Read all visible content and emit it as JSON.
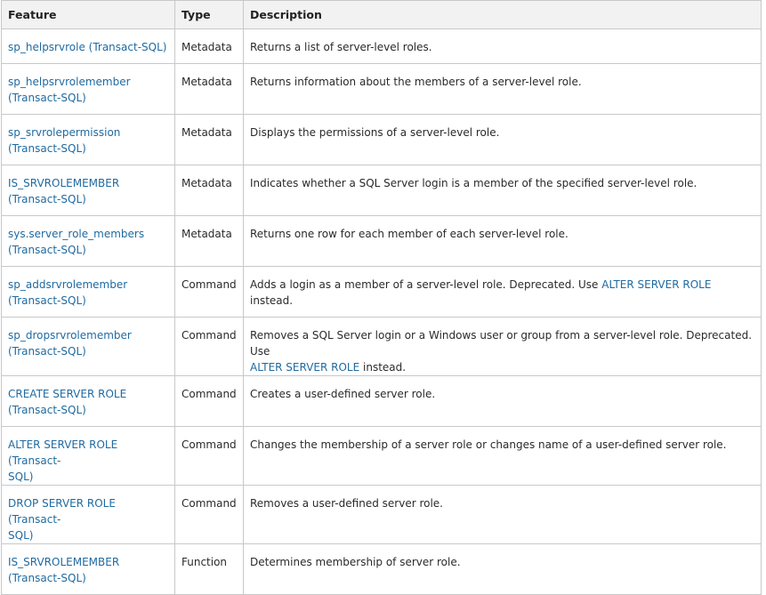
{
  "header": {
    "feature": "Feature",
    "type": "Type",
    "description": "Description"
  },
  "rows": [
    {
      "feature": [
        "sp_helpsrvrole (Transact-SQL)"
      ],
      "type": "Metadata",
      "desc": [
        "Returns a list of server-level roles."
      ]
    },
    {
      "feature": [
        "sp_helpsrvrolemember",
        "(Transact-SQL)"
      ],
      "type": "Metadata",
      "desc": [
        "Returns information about the members of a server-level role."
      ]
    },
    {
      "feature": [
        "sp_srvrolepermission",
        "(Transact-SQL)"
      ],
      "type": "Metadata",
      "desc": [
        "Displays the permissions of a server-level role."
      ]
    },
    {
      "feature": [
        "IS_SRVROLEMEMBER",
        "(Transact-SQL)"
      ],
      "type": "Metadata",
      "desc": [
        "Indicates whether a SQL Server login is a member of the specified server-level role."
      ]
    },
    {
      "feature": [
        "sys.server_role_members",
        "(Transact-SQL)"
      ],
      "type": "Metadata",
      "desc": [
        "Returns one row for each member of each server-level role."
      ]
    },
    {
      "feature": [
        "sp_addsrvrolemember",
        "(Transact-SQL)"
      ],
      "type": "Command",
      "desc_pre": "Adds a login as a member of a server-level role. Deprecated. Use ",
      "desc_link": "ALTER SERVER ROLE",
      "desc_post": " instead."
    },
    {
      "feature": [
        "sp_dropsrvrolemember",
        "(Transact-SQL)"
      ],
      "type": "Command",
      "desc_line1": "Removes a SQL Server login or a Windows user or group from a server-level role. Deprecated. Use",
      "desc_link": "ALTER SERVER ROLE",
      "desc_post": " instead."
    },
    {
      "feature": [
        "CREATE SERVER ROLE",
        "(Transact-SQL)"
      ],
      "type": "Command",
      "desc": [
        "Creates a user-defined server role."
      ]
    },
    {
      "feature": [
        "ALTER SERVER ROLE (Transact-",
        "SQL)"
      ],
      "type": "Command",
      "desc": [
        "Changes the membership of a server role or changes name of a user-defined server role."
      ]
    },
    {
      "feature": [
        "DROP SERVER ROLE (Transact-",
        "SQL)"
      ],
      "type": "Command",
      "desc": [
        "Removes a user-defined server role."
      ]
    },
    {
      "feature": [
        "IS_SRVROLEMEMBER",
        "(Transact-SQL)"
      ],
      "type": "Function",
      "desc": [
        "Determines membership of server role."
      ]
    }
  ]
}
